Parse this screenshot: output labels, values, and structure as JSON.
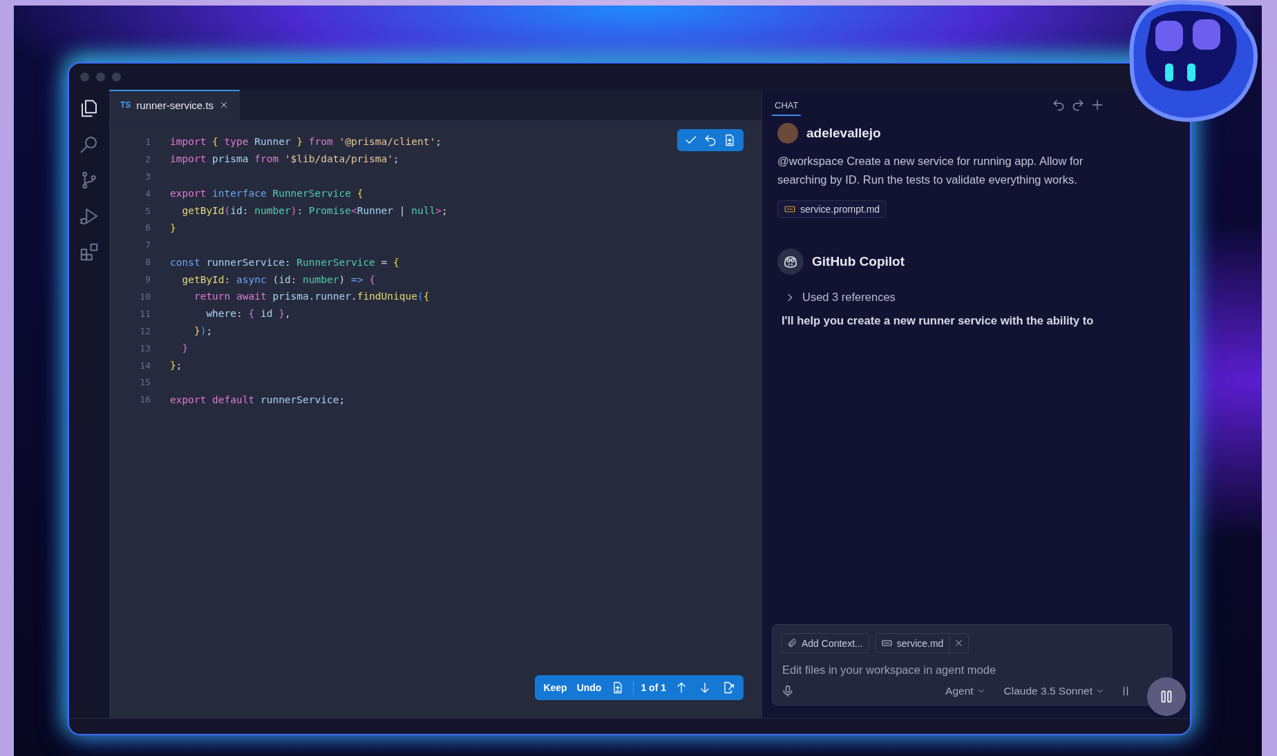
{
  "editor": {
    "tabs": [
      {
        "badge": "TS",
        "label": "runner-service.ts",
        "selected": true
      }
    ],
    "lines": [
      {
        "number": "1",
        "tokens": [
          {
            "kind": "kw",
            "text": "import "
          },
          {
            "kind": "b1",
            "text": "{ "
          },
          {
            "kind": "kw",
            "text": "type "
          },
          {
            "kind": "var",
            "text": "Runner "
          },
          {
            "kind": "b1",
            "text": "} "
          },
          {
            "kind": "kw",
            "text": "from "
          },
          {
            "kind": "str",
            "text": "'@prisma/client'"
          },
          {
            "kind": "p",
            "text": ";"
          }
        ]
      },
      {
        "number": "2",
        "tokens": [
          {
            "kind": "kw",
            "text": "import "
          },
          {
            "kind": "var",
            "text": "prisma "
          },
          {
            "kind": "kw",
            "text": "from "
          },
          {
            "kind": "str",
            "text": "'$lib/data/prisma'"
          },
          {
            "kind": "p",
            "text": ";"
          }
        ]
      },
      {
        "number": "3"
      },
      {
        "number": "4",
        "tokens": [
          {
            "kind": "kw",
            "text": "export "
          },
          {
            "kind": "kw2",
            "text": "interface "
          },
          {
            "kind": "type",
            "text": "RunnerService "
          },
          {
            "kind": "b1",
            "text": "{"
          }
        ]
      },
      {
        "number": "5",
        "tokens": [
          {
            "kind": "fn",
            "text": "  getById"
          },
          {
            "kind": "b2",
            "text": "("
          },
          {
            "kind": "var",
            "text": "id"
          },
          {
            "kind": "p",
            "text": ": "
          },
          {
            "kind": "type",
            "text": "number"
          },
          {
            "kind": "b2",
            "text": ")"
          },
          {
            "kind": "p",
            "text": ": "
          },
          {
            "kind": "type",
            "text": "Promise"
          },
          {
            "kind": "b2",
            "text": "<"
          },
          {
            "kind": "var",
            "text": "Runner"
          },
          {
            "kind": "p",
            "text": " | "
          },
          {
            "kind": "type",
            "text": "null"
          },
          {
            "kind": "b2",
            "text": ">"
          },
          {
            "kind": "p",
            "text": ";"
          }
        ]
      },
      {
        "number": "6",
        "tokens": [
          {
            "kind": "b1",
            "text": "}"
          }
        ]
      },
      {
        "number": "7"
      },
      {
        "number": "8",
        "tokens": [
          {
            "kind": "kw2",
            "text": "const "
          },
          {
            "kind": "var",
            "text": "runnerService"
          },
          {
            "kind": "p",
            "text": ": "
          },
          {
            "kind": "type",
            "text": "RunnerService"
          },
          {
            "kind": "p",
            "text": " = "
          },
          {
            "kind": "b1",
            "text": "{"
          }
        ]
      },
      {
        "number": "9",
        "tokens": [
          {
            "kind": "fn",
            "text": "  getById"
          },
          {
            "kind": "p",
            "text": ": "
          },
          {
            "kind": "kw2",
            "text": "async "
          },
          {
            "kind": "p",
            "text": "("
          },
          {
            "kind": "var",
            "text": "id"
          },
          {
            "kind": "p",
            "text": ": "
          },
          {
            "kind": "type",
            "text": "number"
          },
          {
            "kind": "p",
            "text": ") "
          },
          {
            "kind": "kw2",
            "text": "=> "
          },
          {
            "kind": "b2",
            "text": "{"
          }
        ]
      },
      {
        "number": "10",
        "tokens": [
          {
            "kind": "kw",
            "text": "    return "
          },
          {
            "kind": "kw",
            "text": "await "
          },
          {
            "kind": "var",
            "text": "prisma"
          },
          {
            "kind": "p",
            "text": "."
          },
          {
            "kind": "var",
            "text": "runner"
          },
          {
            "kind": "p",
            "text": "."
          },
          {
            "kind": "fn",
            "text": "findUnique"
          },
          {
            "kind": "b3",
            "text": "("
          },
          {
            "kind": "b1",
            "text": "{"
          }
        ]
      },
      {
        "number": "11",
        "tokens": [
          {
            "kind": "var",
            "text": "      where"
          },
          {
            "kind": "p",
            "text": ": "
          },
          {
            "kind": "b2",
            "text": "{ "
          },
          {
            "kind": "var",
            "text": "id "
          },
          {
            "kind": "b2",
            "text": "}"
          },
          {
            "kind": "p",
            "text": ","
          }
        ]
      },
      {
        "number": "12",
        "tokens": [
          {
            "kind": "b1",
            "text": "    }"
          },
          {
            "kind": "b3",
            "text": ")"
          },
          {
            "kind": "p",
            "text": ";"
          }
        ]
      },
      {
        "number": "13",
        "tokens": [
          {
            "kind": "b2",
            "text": "  }"
          }
        ]
      },
      {
        "number": "14",
        "tokens": [
          {
            "kind": "b1",
            "text": "}"
          },
          {
            "kind": "p",
            "text": ";"
          }
        ]
      },
      {
        "number": "15"
      },
      {
        "number": "16",
        "tokens": [
          {
            "kind": "kw",
            "text": "export "
          },
          {
            "kind": "kw",
            "text": "default "
          },
          {
            "kind": "var",
            "text": "runnerService"
          },
          {
            "kind": "p",
            "text": ";"
          }
        ]
      }
    ],
    "review_bar": {
      "keep": "Keep",
      "undo": "Undo",
      "counter": "1 of 1"
    }
  },
  "chat": {
    "tabs": [
      {
        "label": "CHAT",
        "selected": true
      }
    ],
    "messages": [
      {
        "kind": "user",
        "author": "adelevallejo",
        "text": "@workspace Create a new service for running app. Allow for searching by ID. Run the tests to validate everything works.",
        "attachments": [
          "service.prompt.md"
        ]
      },
      {
        "kind": "assistant",
        "author": "GitHub Copilot",
        "references": {
          "label": "Used 3 references",
          "expanded": false
        },
        "text": "I'll help you create a new runner service with the ability to"
      }
    ],
    "input": {
      "chips": [
        {
          "kind": "action",
          "label": "Add Context..."
        },
        {
          "kind": "file",
          "label": "service.md"
        }
      ],
      "placeholder": "Edit files in your workspace in agent mode",
      "mode": "Agent",
      "model": "Claude 3.5 Sonnet"
    }
  }
}
